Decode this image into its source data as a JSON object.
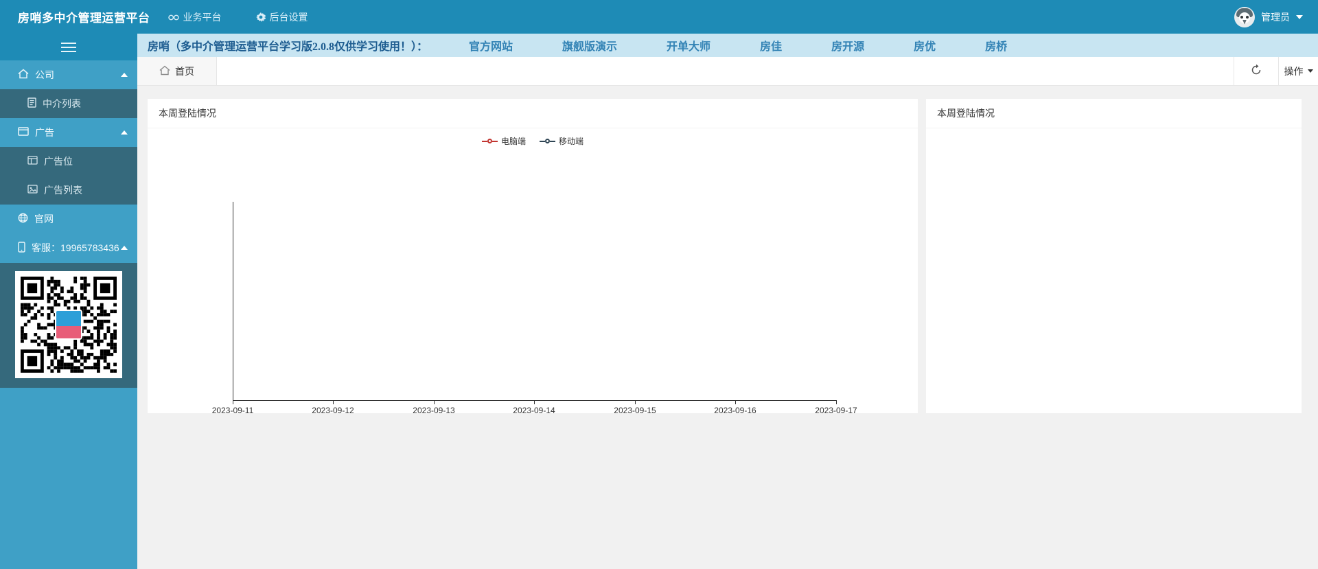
{
  "navbar": {
    "title": "房哨多中介管理运营平台",
    "links": [
      {
        "label": "业务平台",
        "icon": "glasses-icon"
      },
      {
        "label": "后台设置",
        "icon": "gear-icon"
      }
    ],
    "user": {
      "name": "管理员"
    }
  },
  "sidebar": {
    "groups": [
      {
        "label": "公司",
        "icon": "house-icon",
        "expanded": true,
        "children": [
          {
            "label": "中介列表",
            "icon": "document-icon"
          }
        ]
      },
      {
        "label": "广告",
        "icon": "window-icon",
        "expanded": true,
        "children": [
          {
            "label": "广告位",
            "icon": "panel-icon"
          },
          {
            "label": "广告列表",
            "icon": "image-icon"
          }
        ]
      },
      {
        "label": "官网",
        "icon": "globe-icon"
      },
      {
        "label": "客服：19965783436",
        "icon": "phone-icon",
        "expanded": true
      }
    ]
  },
  "notice": {
    "text": "房哨（多中介管理运营平台学习版2.0.8仅供学习使用！）：",
    "links": [
      "官方网站",
      "旗舰版演示",
      "开单大师",
      "房佳",
      "房开源",
      "房优",
      "房桥"
    ]
  },
  "tabbar": {
    "tabs": [
      {
        "label": "首页",
        "active": true
      }
    ],
    "actions": {
      "dropdown_label": "操作"
    }
  },
  "cards": {
    "left": {
      "title": "本周登陆情况"
    },
    "right": {
      "title": "本周登陆情况"
    }
  },
  "chart_data": {
    "type": "line",
    "title": "本周登陆情况",
    "x": [
      "2023-09-11",
      "2023-09-12",
      "2023-09-13",
      "2023-09-14",
      "2023-09-15",
      "2023-09-16",
      "2023-09-17"
    ],
    "series": [
      {
        "name": "电脑端",
        "color": "#c23531",
        "values": []
      },
      {
        "name": "移动端",
        "color": "#2f4554",
        "values": []
      }
    ],
    "legend_position": "top-center",
    "grid_lines": false,
    "xlabel": "",
    "ylabel": "",
    "note_values_plotted": false
  },
  "colors": {
    "navbar_bg": "#1e8bb6",
    "sidebar_bg": "#3fa0c6",
    "submenu_bg": "#35697c",
    "notice_bg": "#c8e5f2",
    "notice_text": "#1d5c90",
    "page_bg": "#f1f1f1",
    "series_pc": "#c23531",
    "series_mobile": "#2f4554"
  }
}
